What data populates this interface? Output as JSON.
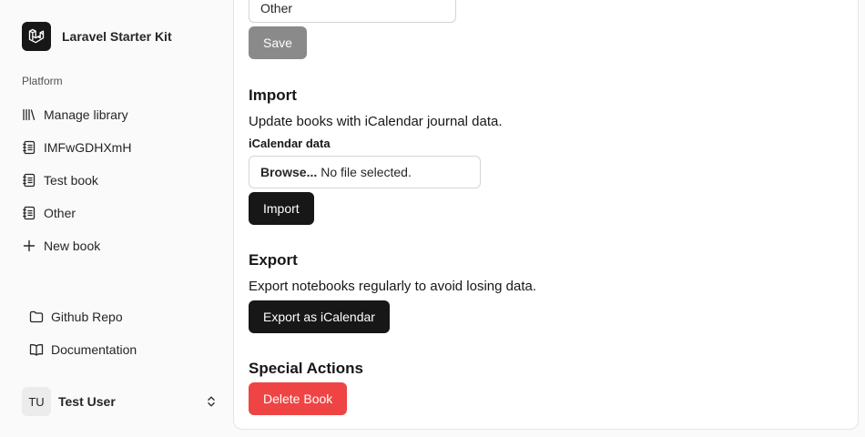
{
  "app": {
    "name": "Laravel Starter Kit"
  },
  "sidebar": {
    "group_label": "Platform",
    "items": [
      {
        "label": "Manage library",
        "icon": "library-icon"
      },
      {
        "label": "IMFwGDHXmH",
        "icon": "notebook-icon"
      },
      {
        "label": "Test book",
        "icon": "notebook-icon"
      },
      {
        "label": "Other",
        "icon": "notebook-icon"
      },
      {
        "label": "New book",
        "icon": "plus-icon"
      }
    ],
    "footer_items": [
      {
        "label": "Github Repo",
        "icon": "folder-icon"
      },
      {
        "label": "Documentation",
        "icon": "book-open-icon"
      }
    ],
    "user": {
      "initials": "TU",
      "name": "Test User"
    }
  },
  "main": {
    "select_value": "Other",
    "save_label": "Save",
    "import": {
      "title": "Import",
      "description": "Update books with iCalendar journal data.",
      "field_label": "iCalendar data",
      "browse_label": "Browse...",
      "file_status": "No file selected.",
      "button_label": "Import"
    },
    "export": {
      "title": "Export",
      "description": "Export notebooks regularly to avoid losing data.",
      "button_label": "Export as iCalendar"
    },
    "special": {
      "title": "Special Actions",
      "delete_label": "Delete Book"
    }
  },
  "colors": {
    "primary_button": "#171717",
    "disabled_button": "#8a8a8a",
    "danger_button": "#ef4444"
  }
}
